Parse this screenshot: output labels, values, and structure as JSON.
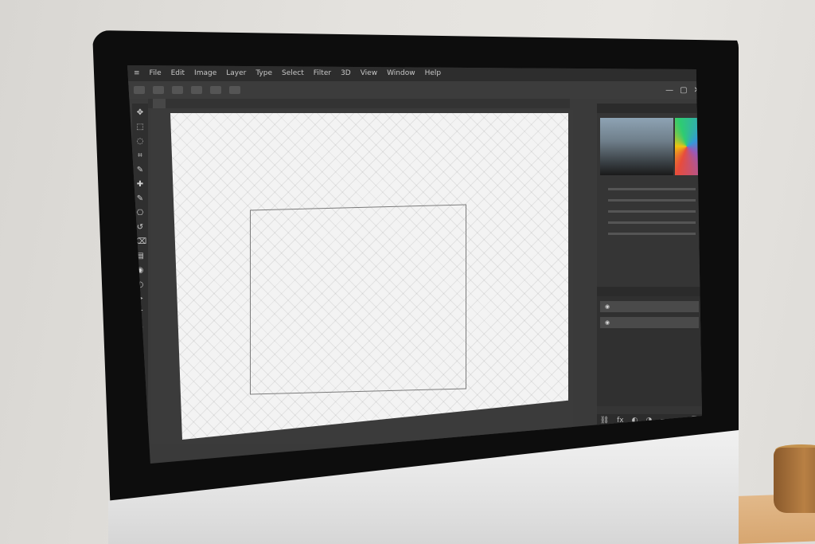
{
  "menus": [
    "≡",
    "File",
    "Edit",
    "Image",
    "Layer",
    "Type",
    "Select",
    "Filter",
    "3D",
    "View",
    "Window",
    "Help"
  ],
  "window_controls": [
    "—",
    "▢",
    "✕"
  ],
  "document_tab": "",
  "tools": [
    "move-icon",
    "marquee-icon",
    "lasso-icon",
    "crop-icon",
    "eyedropper-icon",
    "heal-icon",
    "brush-icon",
    "stamp-icon",
    "history-brush-icon",
    "eraser-icon",
    "gradient-icon",
    "blur-icon",
    "dodge-icon",
    "pen-icon",
    "type-icon",
    "path-select-icon",
    "shape-icon",
    "hand-icon",
    "zoom-icon"
  ],
  "tool_glyphs": [
    "✥",
    "⬚",
    "◌",
    "⌗",
    "✎",
    "✚",
    "✎",
    "⎔",
    "↺",
    "⌫",
    "▤",
    "◉",
    "◐",
    "✒",
    "T",
    "➤",
    "▭",
    "✋",
    "⚲"
  ],
  "status": {
    "zoom": "",
    "info": ""
  },
  "panels": {
    "color": {
      "title": "",
      "field_colors": [
        "#8ea3b4",
        "#1a1a1a"
      ]
    },
    "properties": {
      "rows": [
        "",
        "",
        "",
        "",
        ""
      ]
    },
    "layers": {
      "title": "",
      "rows": [
        "",
        ""
      ]
    }
  },
  "layers_footer_icons": [
    "link-icon",
    "fx-icon",
    "mask-icon",
    "adjustment-icon",
    "folder-icon",
    "new-layer-icon",
    "trash-icon"
  ]
}
